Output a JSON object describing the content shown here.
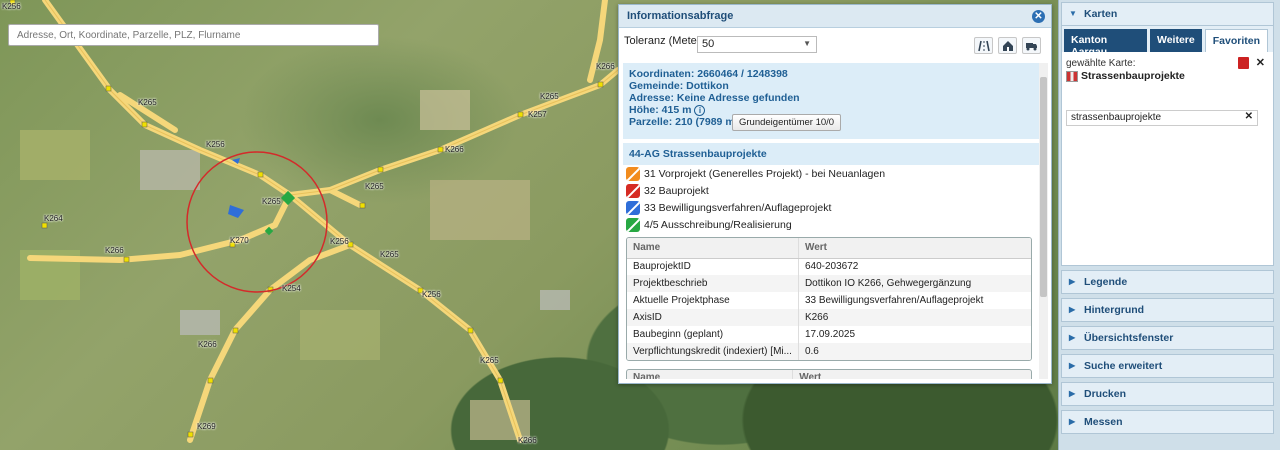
{
  "search": {
    "placeholder": "Adresse, Ort, Koordinate, Parzelle, PLZ, Flurname"
  },
  "map": {
    "road_labels": [
      "K256",
      "K265",
      "K256",
      "K265",
      "K266",
      "K257",
      "K265",
      "K266",
      "K264",
      "K270",
      "K266",
      "K265",
      "K254",
      "K256",
      "K256",
      "K265",
      "K266",
      "K269",
      "K265",
      "K266"
    ]
  },
  "info": {
    "title": "Informationsabfrage",
    "tolerance_label": "Toleranz (Meter):",
    "tolerance_value": "50",
    "coords": "Koordinaten: 2660464 / 1248398",
    "gemeinde": "Gemeinde: Dottikon",
    "adresse": "Adresse: Keine Adresse gefunden",
    "hoehe": "Höhe: 415 m",
    "parzelle": "Parzelle: 210 (7989 m²)",
    "owner_button": "Grundeigentümer 10/0",
    "layer_title": "44-AG Strassenbauprojekte",
    "legend": [
      {
        "label": "31 Vorprojekt (Generelles Projekt) - bei Neuanlagen",
        "color": "#f28c1e"
      },
      {
        "label": "32 Bauprojekt",
        "color": "#d62b23"
      },
      {
        "label": "33 Bewilligungsverfahren/Auflageprojekt",
        "color": "#2f6ed8"
      },
      {
        "label": "4/5 Ausschreibung/Realisierung",
        "color": "#27a843"
      }
    ],
    "table": {
      "col_name": "Name",
      "col_value": "Wert",
      "rows": [
        {
          "name": "BauprojektID",
          "value": "640-203672"
        },
        {
          "name": "Projektbeschrieb",
          "value": "Dottikon IO K266, Gehwegergänzung"
        },
        {
          "name": "Aktuelle Projektphase",
          "value": "33 Bewilligungsverfahren/Auflageprojekt"
        },
        {
          "name": "AxisID",
          "value": "K266"
        },
        {
          "name": "Baubeginn (geplant)",
          "value": "17.09.2025"
        },
        {
          "name": "Verpflichtungskredit (indexiert) [Mi...",
          "value": "0.6"
        }
      ]
    },
    "table2": {
      "col_name": "Name",
      "col_value": "Wert"
    }
  },
  "sidebar": {
    "karten_title": "Karten",
    "tabs": [
      "Kanton Aargau",
      "Weitere",
      "Favoriten"
    ],
    "active_tab": "Favoriten",
    "selected_label": "gewählte Karte:",
    "selected_map": "Strassenbauprojekte",
    "filter_value": "strassenbauprojekte",
    "sections": [
      "Legende",
      "Hintergrund",
      "Übersichtsfenster",
      "Suche erweitert",
      "Drucken",
      "Messen"
    ]
  },
  "colors": {
    "accent": "#1f4e79",
    "panel_header": "#dce9f2",
    "road": "#f5d77a",
    "circle": "#d42a2a"
  }
}
